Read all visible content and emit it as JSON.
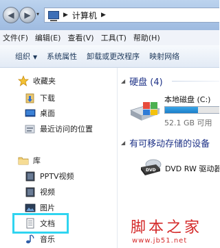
{
  "address": {
    "path": [
      "计算机"
    ]
  },
  "menu": [
    "文件(F)",
    "编辑(E)",
    "查看(V)",
    "工具(T)",
    "帮助(H)"
  ],
  "toolbar": {
    "organize": "组织",
    "items": [
      "系统属性",
      "卸载或更改程序",
      "映射网络"
    ]
  },
  "nav": {
    "favorites_title": "收藏夹",
    "favorites": [
      "下载",
      "桌面",
      "最近访问的位置"
    ],
    "libraries_title": "库",
    "libraries": [
      "PPTV视频",
      "视频",
      "图片",
      "文档",
      "音乐"
    ]
  },
  "content": {
    "hdd_header": "硬盘 (4)",
    "drive_c": {
      "name": "本地磁盘 (C:)",
      "free": "52.1 GB 可用",
      "used_fraction": 0.55
    },
    "removable_header": "有可移动存储的设备",
    "dvd": {
      "name": "DVD RW 驱动器"
    }
  },
  "watermark": {
    "text": "脚本之家",
    "url": "www.jb51.net"
  }
}
